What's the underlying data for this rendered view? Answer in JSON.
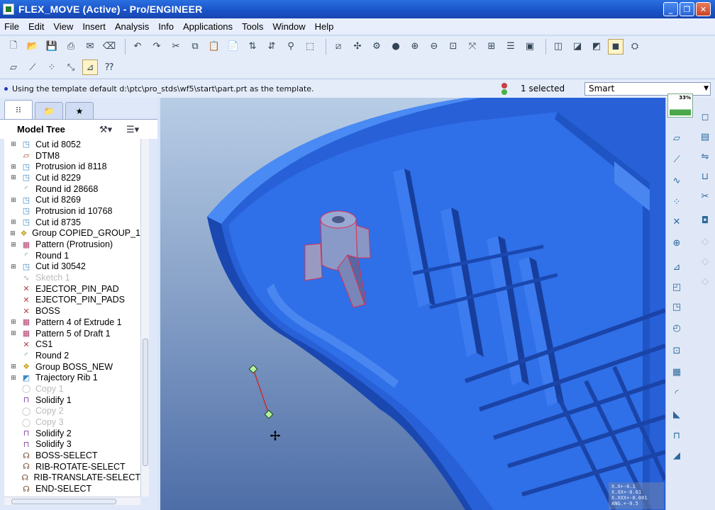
{
  "window": {
    "title": "FLEX_MOVE (Active) - Pro/ENGINEER",
    "controls": [
      "_",
      "❐",
      "✕"
    ]
  },
  "menu": [
    "File",
    "Edit",
    "View",
    "Insert",
    "Analysis",
    "Info",
    "Applications",
    "Tools",
    "Window",
    "Help"
  ],
  "toolbar_row1": [
    "new-icon",
    "open-icon",
    "save-icon",
    "print-icon",
    "send-icon",
    "erase-icon",
    "undo-icon",
    "redo-icon",
    "cut-icon",
    "copy-icon",
    "paste-icon",
    "paste-special-icon",
    "regenerate-icon",
    "regen-manager-icon",
    "find-icon",
    "select-box-icon",
    "sketch-icon",
    "spin-center-icon",
    "orient-icon",
    "appearance-icon",
    "zoom-in-icon",
    "zoom-out-icon",
    "refit-icon",
    "reorient-icon",
    "saved-views-icon",
    "layers-icon",
    "view-manager-icon",
    "wireframe-icon",
    "hidden-line-icon",
    "no-hidden-icon",
    "shading-icon",
    "help-icon"
  ],
  "toolbar_row2": [
    "datum-plane-display-icon",
    "datum-axis-display-icon",
    "datum-point-display-icon",
    "csys-display-icon",
    "annotation-display-icon",
    "context-help-icon"
  ],
  "message": {
    "text": "Using the template default d:\\ptc\\pro_stds\\wf5\\start\\part.prt as the template."
  },
  "status": {
    "selected": "1 selected",
    "filter": "Smart"
  },
  "model_tree": {
    "title": "Model Tree",
    "items": [
      {
        "label": "Cut id 8052",
        "icon": "cut-icon",
        "expand": true,
        "dim": false
      },
      {
        "label": "DTM8",
        "icon": "datum-plane-icon",
        "expand": false,
        "dim": false
      },
      {
        "label": "Protrusion id 8118",
        "icon": "protrusion-icon",
        "expand": true,
        "dim": false
      },
      {
        "label": "Cut id 8229",
        "icon": "cut-icon",
        "expand": true,
        "dim": false
      },
      {
        "label": "Round id 28668",
        "icon": "round-icon",
        "expand": false,
        "dim": false
      },
      {
        "label": "Cut id 8269",
        "icon": "cut-icon",
        "expand": true,
        "dim": false
      },
      {
        "label": "Protrusion id 10768",
        "icon": "protrusion-icon",
        "expand": false,
        "dim": false
      },
      {
        "label": "Cut id 8735",
        "icon": "cut-icon",
        "expand": true,
        "dim": false
      },
      {
        "label": "Group COPIED_GROUP_1",
        "icon": "group-icon",
        "expand": true,
        "dim": false
      },
      {
        "label": "Pattern (Protrusion)",
        "icon": "pattern-icon",
        "expand": true,
        "dim": false
      },
      {
        "label": "Round 1",
        "icon": "round-icon",
        "expand": false,
        "dim": false
      },
      {
        "label": "Cut id 30542",
        "icon": "cut-icon",
        "expand": true,
        "dim": false
      },
      {
        "label": "Sketch 1",
        "icon": "sketch-icon",
        "expand": false,
        "dim": true
      },
      {
        "label": "EJECTOR_PIN_PAD",
        "icon": "datum-point-icon",
        "expand": false,
        "dim": false
      },
      {
        "label": "EJECTOR_PIN_PADS",
        "icon": "datum-point-icon",
        "expand": false,
        "dim": false
      },
      {
        "label": "BOSS",
        "icon": "datum-point-icon",
        "expand": false,
        "dim": false
      },
      {
        "label": "Pattern 4 of Extrude 1",
        "icon": "pattern-icon",
        "expand": true,
        "dim": false
      },
      {
        "label": "Pattern 5 of Draft 1",
        "icon": "pattern-icon",
        "expand": true,
        "dim": false
      },
      {
        "label": "CS1",
        "icon": "csys-icon",
        "expand": false,
        "dim": false
      },
      {
        "label": "Round 2",
        "icon": "round-icon",
        "expand": false,
        "dim": false
      },
      {
        "label": "Group BOSS_NEW",
        "icon": "group-icon",
        "expand": true,
        "dim": false
      },
      {
        "label": "Trajectory Rib 1",
        "icon": "rib-icon",
        "expand": true,
        "dim": false
      },
      {
        "label": "Copy 1",
        "icon": "copy-feature-icon",
        "expand": false,
        "dim": true
      },
      {
        "label": "Solidify 1",
        "icon": "solidify-icon",
        "expand": false,
        "dim": false
      },
      {
        "label": "Copy 2",
        "icon": "copy-feature-icon",
        "expand": false,
        "dim": true
      },
      {
        "label": "Copy 3",
        "icon": "copy-feature-icon",
        "expand": false,
        "dim": true
      },
      {
        "label": "Solidify 2",
        "icon": "solidify-icon",
        "expand": false,
        "dim": false
      },
      {
        "label": "Solidify 3",
        "icon": "solidify-icon",
        "expand": false,
        "dim": false
      },
      {
        "label": "BOSS-SELECT",
        "icon": "udf-icon",
        "expand": false,
        "dim": false
      },
      {
        "label": "RIB-ROTATE-SELECT",
        "icon": "udf-icon",
        "expand": false,
        "dim": false
      },
      {
        "label": "RIB-TRANSLATE-SELECT",
        "icon": "udf-icon",
        "expand": false,
        "dim": false
      },
      {
        "label": "END-SELECT",
        "icon": "udf-icon",
        "expand": false,
        "dim": false
      }
    ]
  },
  "graphics": {
    "coords": [
      "X.X+-0.1",
      "X.XX+-0.01",
      "X.XXX+-0.001",
      "ANG.+-0.5"
    ]
  },
  "right_toolbar": {
    "thumbnail_pct": "33%",
    "icons": [
      "datum-plane-icon",
      "datum-axis-icon",
      "datum-curve-icon",
      "datum-point-icon",
      "csys-icon",
      "analysis-icon",
      "sketch-icon",
      "extrude-icon",
      "revolve-icon",
      "sweep-icon",
      "blend-icon",
      "hole-icon",
      "round-icon",
      "chamfer-icon",
      "rib-icon",
      "draft-icon",
      "shell-icon",
      "pattern-icon",
      "mirror-icon",
      "merge-icon",
      "trim-icon",
      "offset-icon"
    ]
  },
  "colors": {
    "model": "#2f6fe8",
    "highlight": "#e03050",
    "titlebar": "#1a52c8"
  }
}
